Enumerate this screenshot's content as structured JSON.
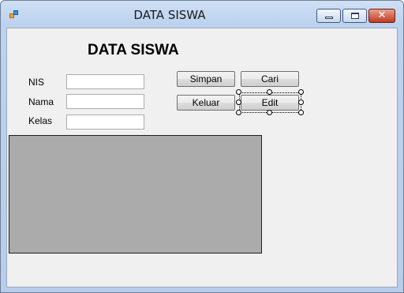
{
  "window": {
    "title": "DATA SISWA",
    "close_glyph": "✕"
  },
  "form": {
    "heading": "DATA SISWA",
    "fields": [
      {
        "label": "NIS",
        "value": ""
      },
      {
        "label": "Nama",
        "value": ""
      },
      {
        "label": "Kelas",
        "value": ""
      }
    ],
    "buttons": {
      "simpan": "Simpan",
      "cari": "Cari",
      "keluar": "Keluar",
      "edit": "Edit"
    }
  },
  "icons": {
    "app": "app-form-icon",
    "minimize": "minimize-icon",
    "maximize": "maximize-icon",
    "close": "close-icon"
  },
  "colors": {
    "titlebar": "#bcd2ee",
    "client_background": "#f0f0f0",
    "grid_background": "#ababab",
    "close_button": "#c13a23"
  }
}
